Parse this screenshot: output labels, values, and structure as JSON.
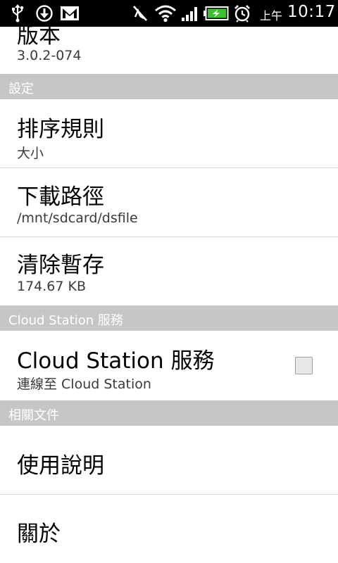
{
  "status_bar": {
    "time_prefix": "上午",
    "time": "10:17",
    "icons": [
      "usb-icon",
      "download-icon",
      "gmail-icon",
      "mute-icon",
      "wifi-icon",
      "signal-icon",
      "battery-charging-icon",
      "alarm-icon"
    ]
  },
  "version": {
    "title": "版本",
    "value": "3.0.2-074"
  },
  "sections": {
    "settings": "設定",
    "cloud_station": "Cloud Station 服務",
    "related_docs": "相關文件"
  },
  "settings": {
    "sort_rule": {
      "title": "排序規則",
      "summary": "大小"
    },
    "download_path": {
      "title": "下載路徑",
      "summary": "/mnt/sdcard/dsfile"
    },
    "clear_cache": {
      "title": "清除暫存",
      "summary": "174.67 KB"
    }
  },
  "cloud_station": {
    "title": "Cloud Station 服務",
    "summary": "連線至 Cloud Station",
    "checked": false
  },
  "related_docs": {
    "help": {
      "title": "使用說明"
    },
    "about": {
      "title": "關於"
    }
  },
  "colors": {
    "status_bar_bg": "#000000",
    "section_header_bg": "#c6c6c6",
    "battery_green": "#3fbf2f"
  }
}
